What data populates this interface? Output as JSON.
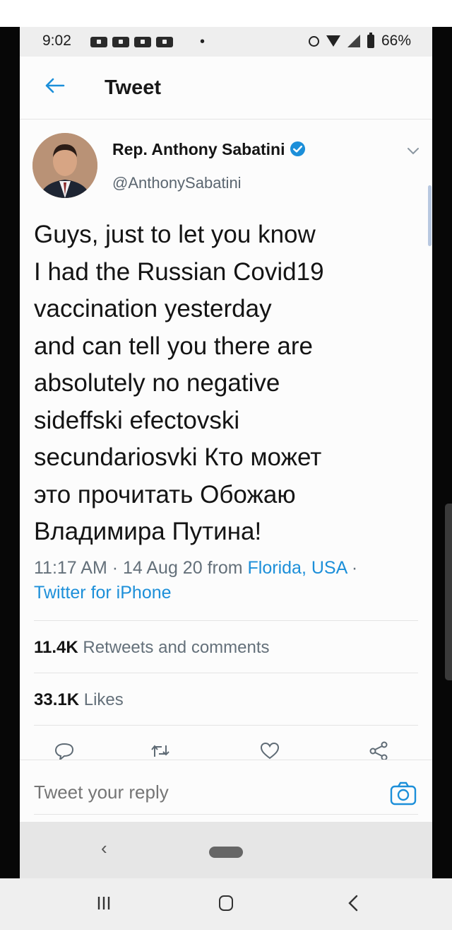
{
  "status_bar": {
    "time": "9:02",
    "battery": "66%",
    "icons": [
      "notification-icon",
      "notification-icon",
      "notification-icon",
      "notification-icon",
      "alarm-icon",
      "wifi-icon",
      "signal-icon",
      "battery-icon"
    ]
  },
  "header": {
    "title": "Tweet",
    "back_icon": "arrow-left-icon"
  },
  "tweet": {
    "author_name": "Rep. Anthony Sabatini",
    "handle": "@AnthonySabatini",
    "verified": true,
    "text": "Guys, just to let you know\nI had the Russian Covid19\nvaccination yesterday\nand can tell you there are\nabsolutely no negative\nsideffski efectovski\nsecundariosvki Кто может\nэто прочитать Обожаю\nВладимира Путина!",
    "time": "11:17 AM",
    "date": "14 Aug 20",
    "from_label": "from",
    "location": "Florida, USA",
    "client": "Twitter for iPhone"
  },
  "stats": {
    "retweets_count": "11.4K",
    "retweets_label": "Retweets and comments",
    "likes_count": "33.1K",
    "likes_label": "Likes"
  },
  "actions": [
    "reply-icon",
    "retweet-icon",
    "like-icon",
    "share-icon"
  ],
  "reply_bar": {
    "placeholder": "Tweet your reply"
  },
  "colors": {
    "accent": "#1c8fd9",
    "text": "#141414",
    "secondary_text": "#64707a",
    "divider": "#e4e4e4"
  }
}
